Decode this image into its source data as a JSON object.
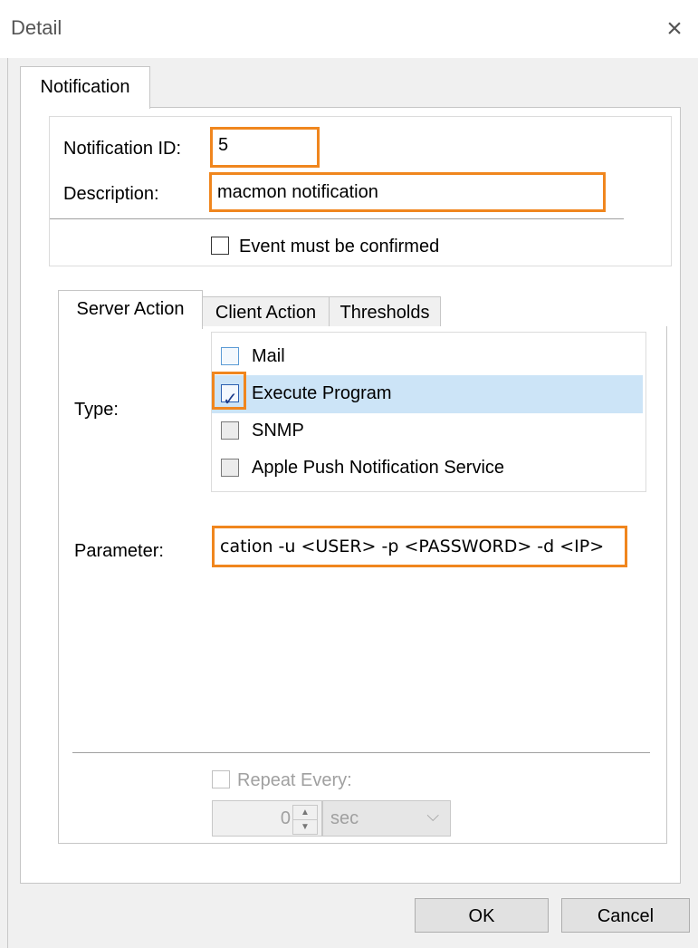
{
  "window": {
    "title": "Detail",
    "close_icon": "×"
  },
  "outer_tab": "Notification",
  "notification": {
    "id_label": "Notification ID:",
    "id_value": "5",
    "description_label": "Description:",
    "description_value": "macmon notification",
    "confirm_label": "Event must be confirmed"
  },
  "inner_tabs": [
    "Server Action",
    "Client Action",
    "Thresholds"
  ],
  "server_action": {
    "type_label": "Type:",
    "types": [
      {
        "label": "Mail",
        "checked": false
      },
      {
        "label": "Execute Program",
        "checked": true
      },
      {
        "label": "SNMP",
        "checked": false
      },
      {
        "label": "Apple Push Notification Service",
        "checked": false
      }
    ],
    "parameter_label": "Parameter:",
    "parameter_value": "cation -u <USER> -p <PASSWORD> -d <IP>",
    "repeat_label": "Repeat Every:",
    "repeat_value": "0",
    "repeat_unit": "sec"
  },
  "buttons": {
    "ok": "OK",
    "cancel": "Cancel"
  },
  "colors": {
    "highlight": "#f0861e",
    "selection": "#cce4f7"
  }
}
